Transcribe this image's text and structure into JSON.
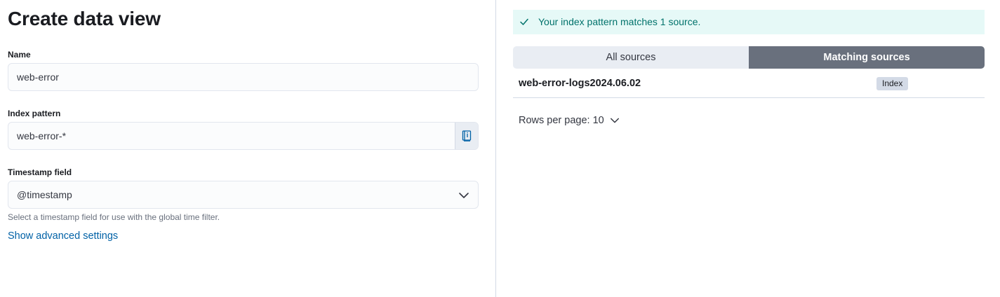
{
  "left": {
    "title": "Create data view",
    "name": {
      "label": "Name",
      "value": "web-error"
    },
    "index_pattern": {
      "label": "Index pattern",
      "value": "web-error-*"
    },
    "timestamp": {
      "label": "Timestamp field",
      "value": "@timestamp",
      "help": "Select a timestamp field for use with the global time filter."
    },
    "advanced_link": "Show advanced settings"
  },
  "right": {
    "callout": "Your index pattern matches 1 source.",
    "tabs": [
      {
        "label": "All sources",
        "selected": false
      },
      {
        "label": "Matching sources",
        "selected": true
      }
    ],
    "rows": [
      {
        "name": "web-error-logs2024.06.02",
        "type": "Index"
      }
    ],
    "rows_per_page": "Rows per page: 10"
  },
  "colors": {
    "success_text": "#00726b",
    "success_bg": "#e6f9f7",
    "link": "#0061a6",
    "selected_tab": "#69707d"
  }
}
